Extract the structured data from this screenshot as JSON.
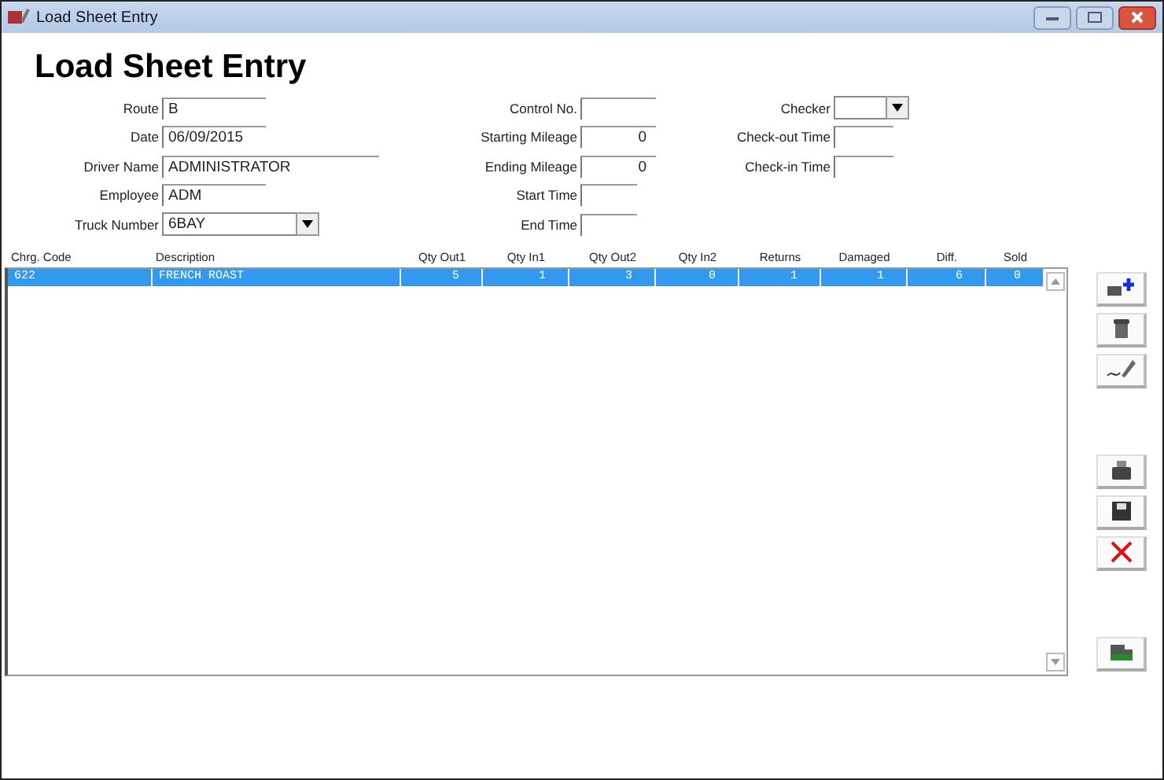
{
  "window": {
    "title": "Load Sheet Entry"
  },
  "heading": "Load Sheet Entry",
  "fields_left": [
    {
      "label": "Route",
      "value": "B",
      "kind": "text"
    },
    {
      "label": "Date",
      "value": "06/09/2015",
      "kind": "text"
    },
    {
      "label": "Driver Name",
      "value": "ADMINISTRATOR",
      "kind": "wide"
    },
    {
      "label": "Employee",
      "value": "ADM",
      "kind": "text"
    },
    {
      "label": "Truck Number",
      "value": "6BAY",
      "kind": "dropdown"
    }
  ],
  "fields_middle": [
    {
      "label": "Control No.",
      "kind": "text"
    },
    {
      "label": "Starting Mileage",
      "value": "0",
      "kind": "number"
    },
    {
      "label": "Ending Mileage",
      "value": "0",
      "kind": "number"
    },
    {
      "label": "Start Time",
      "kind": "time"
    },
    {
      "label": "End Time",
      "kind": "time"
    }
  ],
  "fields_right": [
    {
      "label": "Checker",
      "kind": "dropdown"
    },
    {
      "label": "Check-out Time",
      "kind": "time"
    },
    {
      "label": "Check-in Time",
      "kind": "time"
    }
  ],
  "table": {
    "columns": [
      "Chrg. Code",
      "Description",
      "Qty Out1",
      "Qty In1",
      "Qty Out2",
      "Qty In2",
      "Returns",
      "Damaged",
      "Diff.",
      "Sold"
    ],
    "rows": [
      {
        "selected": true,
        "cells": [
          "622",
          "FRENCH ROAST",
          "5",
          "1",
          "3",
          "0",
          "1",
          "1",
          "6",
          "0"
        ]
      }
    ]
  },
  "toolbar": [
    {
      "kind": "add"
    },
    {
      "kind": "delete"
    },
    {
      "kind": "sign"
    },
    {
      "kind": "gap"
    },
    {
      "kind": "print"
    },
    {
      "kind": "save"
    },
    {
      "kind": "cancel"
    },
    {
      "kind": "gap"
    },
    {
      "kind": "truck"
    }
  ]
}
